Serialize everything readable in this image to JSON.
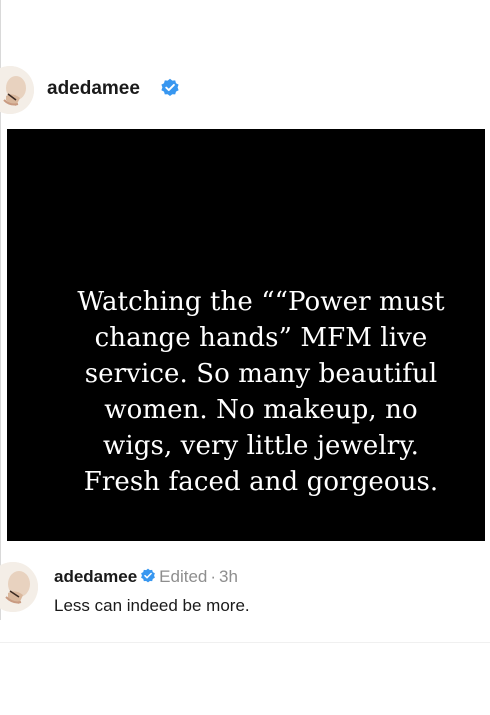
{
  "post": {
    "username": "adedamee",
    "verified_icon": "verified-badge-icon",
    "image_caption": "Watching the ““Power must change hands” MFM live service. So many beautiful women. No makeup, no wigs, very little jewelry. Fresh faced and gorgeous."
  },
  "comment": {
    "username": "adedamee",
    "edited_label": "Edited",
    "separator": "·",
    "time": "3h",
    "text": "Less can indeed be more."
  },
  "colors": {
    "verified_blue": "#3897f0",
    "image_background": "#000000",
    "muted_text": "#8e8e8e"
  }
}
